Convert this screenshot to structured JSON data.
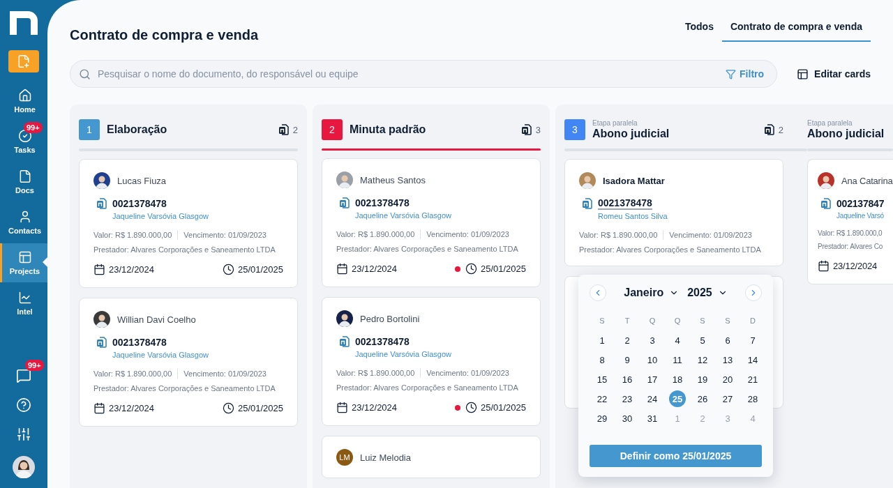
{
  "sidebar": {
    "items": [
      {
        "label": "Home",
        "selected": false
      },
      {
        "label": "Tasks",
        "badge": "99+",
        "selected": false
      },
      {
        "label": "Docs",
        "selected": false
      },
      {
        "label": "Contacts",
        "selected": false
      },
      {
        "label": "Projects",
        "selected": true
      },
      {
        "label": "Intel",
        "selected": false
      }
    ],
    "chat_badge": "99+"
  },
  "header": {
    "title": "Contrato de compra e venda",
    "tabs": [
      {
        "label": "Todos",
        "selected": false
      },
      {
        "label": "Contrato de compra e venda",
        "selected": true
      }
    ]
  },
  "search": {
    "placeholder": "Pesquisar o nome do documento, do responsável ou equipe",
    "filter": "Filtro"
  },
  "edit_cards": "Editar cards",
  "stages": [
    {
      "kind": "single",
      "number": "1",
      "color": "#4597d0",
      "title": "Elaboração",
      "count": "2",
      "highlighted": false,
      "cards": [
        {
          "kind": "full",
          "avatar": {
            "kind": "photo",
            "color": "#1f3f8f"
          },
          "name": "Lucas Fiuza",
          "number": "0021378478",
          "owner": "Jaqueline Varsóvia Glasgow",
          "value": "Valor: R$ 1.890.000,00",
          "due": "Vencimento: 01/09/2023",
          "provider": "Prestador: Alvares Corporações e Saneamento LTDA",
          "start": "23/12/2024",
          "end": "25/01/2025",
          "overdue": false,
          "hovered": false
        },
        {
          "kind": "full",
          "avatar": {
            "kind": "photo",
            "color": "#3a3a3a"
          },
          "name": "Willian Davi Coelho",
          "number": "0021378478",
          "owner": "Jaqueline Varsóvia Glasgow",
          "value": "Valor: R$ 1.890.000,00",
          "due": "Vencimento: 01/09/2023",
          "provider": "Prestador: Alvares Corporações e Saneamento LTDA",
          "start": "23/12/2024",
          "end": "25/01/2025",
          "overdue": false,
          "hovered": false
        }
      ]
    },
    {
      "kind": "single",
      "number": "2",
      "color": "#e8173f",
      "title": "Minuta padrão",
      "count": "3",
      "highlighted": true,
      "cards": [
        {
          "kind": "full",
          "avatar": {
            "kind": "photo",
            "color": "#9aa0a6"
          },
          "name": "Matheus Santos",
          "number": "0021378478",
          "owner": "Jaqueline Varsóvia Glasgow",
          "value": "Valor: R$ 1.890.000,00",
          "due": "Vencimento: 01/09/2023",
          "provider": "Prestador: Alvares Corporações e Saneamento LTDA",
          "start": "23/12/2024",
          "end": "25/01/2025",
          "overdue": true,
          "hovered": false
        },
        {
          "kind": "full",
          "avatar": {
            "kind": "photo",
            "color": "#17224a"
          },
          "name": "Pedro Bortolini",
          "number": "0021378478",
          "owner": "Jaqueline Varsóvia Glasgow",
          "value": "Valor: R$ 1.890.000,00",
          "due": "Vencimento: 01/09/2023",
          "provider": "Prestador: Alvares Corporações e Saneamento LTDA",
          "start": "23/12/2024",
          "end": "25/01/2025",
          "overdue": true,
          "hovered": false
        },
        {
          "kind": "full",
          "avatar": {
            "kind": "initials",
            "color": "#8a5a14",
            "initials": "LM"
          },
          "name": "Luiz Melodia",
          "hovered": false
        }
      ]
    },
    {
      "kind": "parallel",
      "number": "3",
      "color": "#4285f4",
      "branches": [
        {
          "subtitle": "Etapa paralela",
          "title": "Abono judicial",
          "count": "2",
          "cards": [
            {
              "kind": "full",
              "avatar": {
                "kind": "photo",
                "color": "#b08a5a"
              },
              "name": "Isadora Mattar",
              "number": "0021378478",
              "owner": "Romeu Santos Silva",
              "value": "Valor: R$ 1.890.000,00",
              "due": "Vencimento: 01/09/2023",
              "provider": "Prestador: Alvares Corporações e Saneamento LTDA",
              "hovered": true
            },
            {
              "kind": "hidden"
            }
          ]
        },
        {
          "subtitle": "Etapa paralela",
          "title": "Abono judicial",
          "cards": [
            {
              "kind": "full",
              "avatar": {
                "kind": "photo",
                "color": "#b8322a"
              },
              "name": "Ana Catarina",
              "number": "002137847",
              "owner": "Jaqueline Varsó",
              "value": "Valor: R$ 1.890.000,0",
              "provider": "Prestador: Alvares Co",
              "start": "23/12/2024",
              "hovered": false
            }
          ]
        }
      ]
    }
  ],
  "calendar": {
    "month": "Janeiro",
    "year": "2025",
    "weekdays": [
      "S",
      "T",
      "Q",
      "Q",
      "S",
      "S",
      "D"
    ],
    "days": [
      {
        "label": "1",
        "muted": false,
        "selected": false
      },
      {
        "label": "2",
        "muted": false,
        "selected": false
      },
      {
        "label": "3",
        "muted": false,
        "selected": false
      },
      {
        "label": "4",
        "muted": false,
        "selected": false
      },
      {
        "label": "5",
        "muted": false,
        "selected": false
      },
      {
        "label": "6",
        "muted": false,
        "selected": false
      },
      {
        "label": "7",
        "muted": false,
        "selected": false
      },
      {
        "label": "8",
        "muted": false,
        "selected": false
      },
      {
        "label": "9",
        "muted": false,
        "selected": false
      },
      {
        "label": "10",
        "muted": false,
        "selected": false
      },
      {
        "label": "11",
        "muted": false,
        "selected": false
      },
      {
        "label": "12",
        "muted": false,
        "selected": false
      },
      {
        "label": "13",
        "muted": false,
        "selected": false
      },
      {
        "label": "14",
        "muted": false,
        "selected": false
      },
      {
        "label": "15",
        "muted": false,
        "selected": false
      },
      {
        "label": "16",
        "muted": false,
        "selected": false
      },
      {
        "label": "17",
        "muted": false,
        "selected": false
      },
      {
        "label": "18",
        "muted": false,
        "selected": false
      },
      {
        "label": "19",
        "muted": false,
        "selected": false
      },
      {
        "label": "20",
        "muted": false,
        "selected": false
      },
      {
        "label": "21",
        "muted": false,
        "selected": false
      },
      {
        "label": "22",
        "muted": false,
        "selected": false
      },
      {
        "label": "23",
        "muted": false,
        "selected": false
      },
      {
        "label": "24",
        "muted": false,
        "selected": false
      },
      {
        "label": "25",
        "muted": false,
        "selected": true
      },
      {
        "label": "26",
        "muted": false,
        "selected": false
      },
      {
        "label": "27",
        "muted": false,
        "selected": false
      },
      {
        "label": "28",
        "muted": false,
        "selected": false
      },
      {
        "label": "29",
        "muted": false,
        "selected": false
      },
      {
        "label": "30",
        "muted": false,
        "selected": false
      },
      {
        "label": "31",
        "muted": false,
        "selected": false
      },
      {
        "label": "1",
        "muted": true,
        "selected": false
      },
      {
        "label": "2",
        "muted": true,
        "selected": false
      },
      {
        "label": "3",
        "muted": true,
        "selected": false
      },
      {
        "label": "4",
        "muted": true,
        "selected": false
      }
    ],
    "button": "Definir como 25/01/2025"
  }
}
